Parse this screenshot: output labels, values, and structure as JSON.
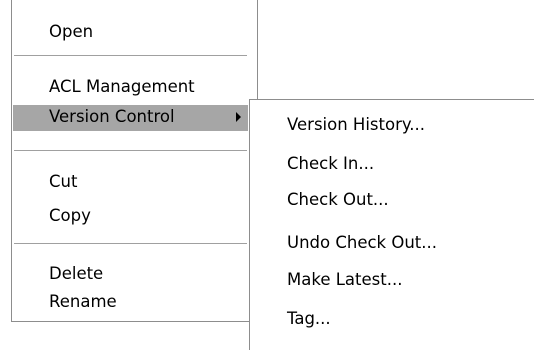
{
  "context_menu": {
    "items": [
      {
        "label": "Open"
      },
      {
        "label": "ACL Management"
      },
      {
        "label": "Version Control"
      },
      {
        "label": "Cut"
      },
      {
        "label": "Copy"
      },
      {
        "label": "Delete"
      },
      {
        "label": "Rename"
      }
    ],
    "selected_item": "Version Control",
    "selected_color": "#a6a6a6"
  },
  "version_control_submenu": {
    "items": [
      {
        "label": "Version History..."
      },
      {
        "label": "Check In..."
      },
      {
        "label": "Check Out..."
      },
      {
        "label": "Undo Check Out..."
      },
      {
        "label": "Make Latest..."
      },
      {
        "label": "Tag..."
      }
    ]
  },
  "icons": {
    "submenu_arrow": "chevron-right-icon"
  }
}
